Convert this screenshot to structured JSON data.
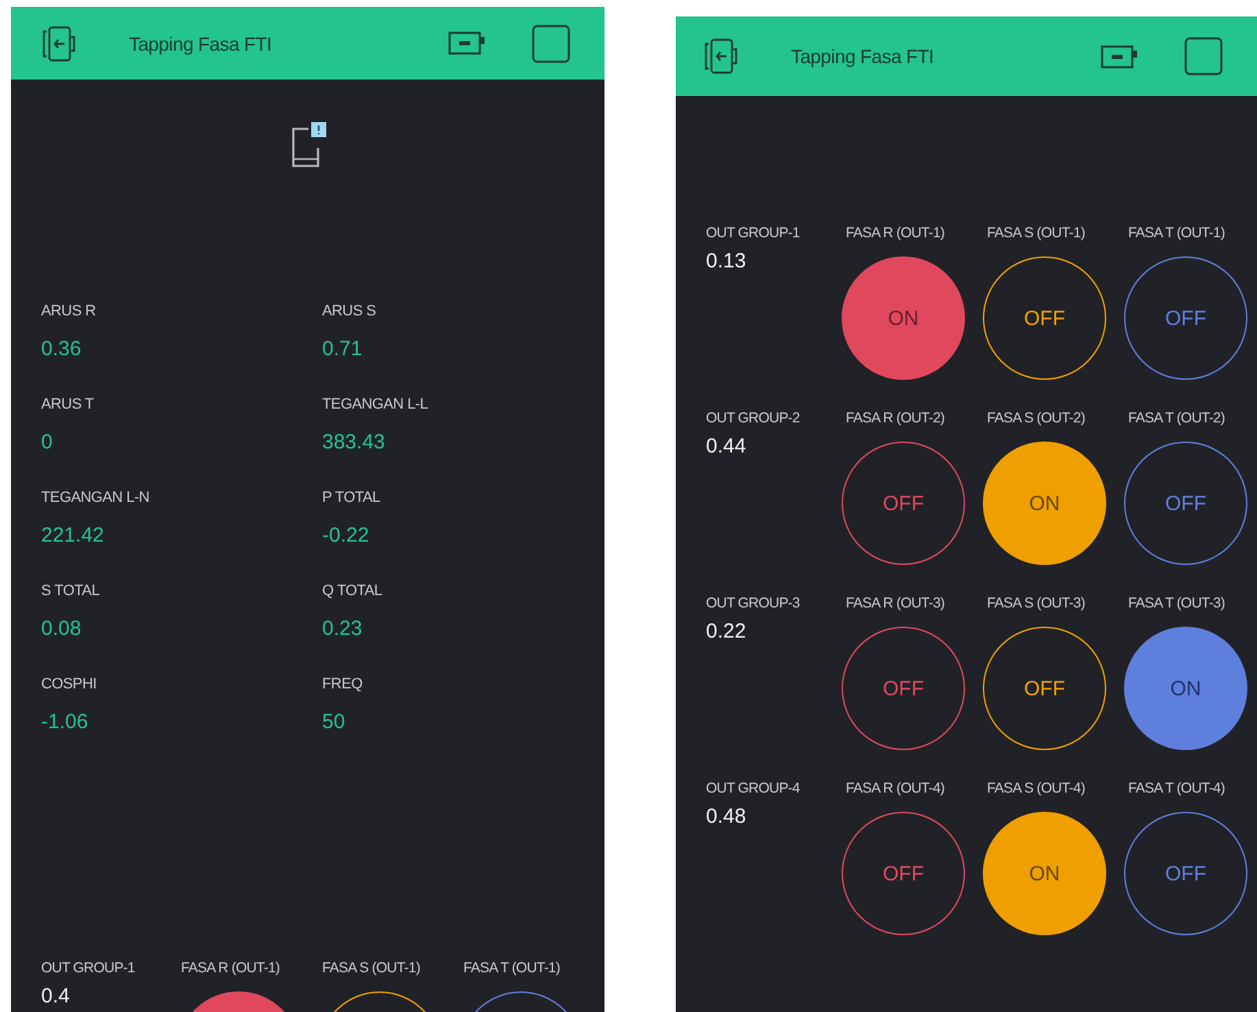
{
  "screens": [
    {
      "title": "Tapping Fasa FTI",
      "notice": true,
      "metrics": [
        {
          "label": "ARUS R",
          "value": "0.36"
        },
        {
          "label": "ARUS S",
          "value": "0.71"
        },
        {
          "label": "ARUS T",
          "value": "0"
        },
        {
          "label": "TEGANGAN L-L",
          "value": "383.43"
        },
        {
          "label": "TEGANGAN L-N",
          "value": "221.42"
        },
        {
          "label": "P TOTAL",
          "value": "-0.22"
        },
        {
          "label": "S TOTAL",
          "value": "0.08"
        },
        {
          "label": "Q TOTAL",
          "value": "0.23"
        },
        {
          "label": "COSPHI",
          "value": "-1.06"
        },
        {
          "label": "FREQ",
          "value": "50"
        }
      ],
      "groups": [
        {
          "label": "OUT GROUP-1",
          "value": "0.4",
          "switches": [
            {
              "label": "FASA R (OUT-1)",
              "color": "#e0485e",
              "on": true
            },
            {
              "label": "FASA S (OUT-1)",
              "color": "#efa000",
              "on": false
            },
            {
              "label": "FASA T (OUT-1)",
              "color": "#5f7fdc",
              "on": false
            }
          ]
        }
      ]
    },
    {
      "title": "Tapping Fasa FTI",
      "notice": false,
      "groups": [
        {
          "label": "OUT GROUP-1",
          "value": "0.13",
          "switches": [
            {
              "label": "FASA R (OUT-1)",
              "color": "#e0485e",
              "on": true,
              "text": "ON"
            },
            {
              "label": "FASA S (OUT-1)",
              "color": "#efa000",
              "on": false,
              "text": "OFF"
            },
            {
              "label": "FASA T (OUT-1)",
              "color": "#5f7fdc",
              "on": false,
              "text": "OFF"
            }
          ]
        },
        {
          "label": "OUT GROUP-2",
          "value": "0.44",
          "switches": [
            {
              "label": "FASA R (OUT-2)",
              "color": "#e0485e",
              "on": false,
              "text": "OFF"
            },
            {
              "label": "FASA S (OUT-2)",
              "color": "#efa000",
              "on": true,
              "text": "ON"
            },
            {
              "label": "FASA T (OUT-2)",
              "color": "#5f7fdc",
              "on": false,
              "text": "OFF"
            }
          ]
        },
        {
          "label": "OUT GROUP-3",
          "value": "0.22",
          "switches": [
            {
              "label": "FASA R (OUT-3)",
              "color": "#e0485e",
              "on": false,
              "text": "OFF"
            },
            {
              "label": "FASA S (OUT-3)",
              "color": "#efa000",
              "on": false,
              "text": "OFF"
            },
            {
              "label": "FASA T (OUT-3)",
              "color": "#5f7fdc",
              "on": true,
              "text": "ON"
            }
          ]
        },
        {
          "label": "OUT GROUP-4",
          "value": "0.48",
          "switches": [
            {
              "label": "FASA R (OUT-4)",
              "color": "#e0485e",
              "on": false,
              "text": "OFF"
            },
            {
              "label": "FASA S (OUT-4)",
              "color": "#efa000",
              "on": true,
              "text": "ON"
            },
            {
              "label": "FASA T (OUT-4)",
              "color": "#5f7fdc",
              "on": false,
              "text": "OFF"
            }
          ]
        }
      ]
    }
  ]
}
